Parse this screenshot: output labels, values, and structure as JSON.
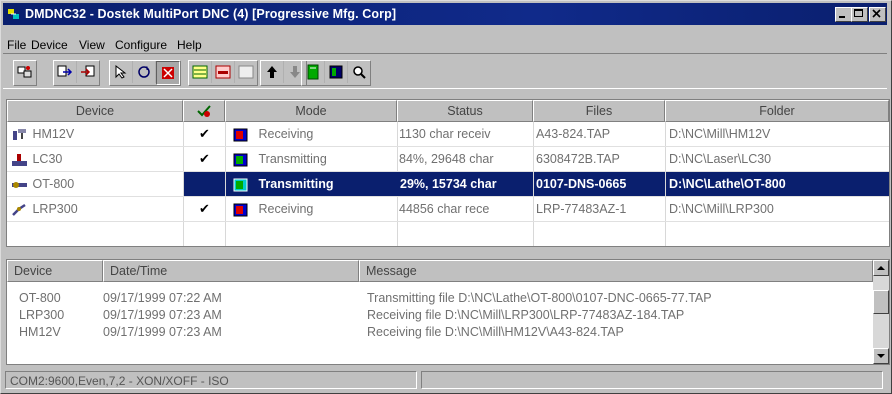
{
  "window": {
    "title": "DMDNC32 - Dostek MultiPort DNC (4) [Progressive Mfg. Corp]"
  },
  "menu": [
    "File",
    "Device",
    "View",
    "Configure",
    "Help"
  ],
  "device_table": {
    "columns": [
      "Device",
      "",
      "Mode",
      "Status",
      "Files",
      "Folder"
    ],
    "rows": [
      {
        "device": "HM12V",
        "checked": "✔",
        "mode": "Receiving",
        "status": "1130 char receiv",
        "file": "A43-824.TAP",
        "folder": "D:\\NC\\Mill\\HM12V"
      },
      {
        "device": "LC30",
        "checked": "✔",
        "mode": "Transmitting",
        "status": "84%, 29648 char",
        "file": "6308472B.TAP",
        "folder": "D:\\NC\\Laser\\LC30"
      },
      {
        "device": "OT-800",
        "checked": "",
        "mode": "Transmitting",
        "status": "29%, 15734 char",
        "file": "0107-DNS-0665",
        "folder": "D:\\NC\\Lathe\\OT-800"
      },
      {
        "device": "LRP300",
        "checked": "✔",
        "mode": "Receiving",
        "status": "44856 char rece",
        "file": "LRP-77483AZ-1",
        "folder": "D:\\NC\\Mill\\LRP300"
      }
    ],
    "selected_row": 2
  },
  "log_table": {
    "columns": [
      "Device",
      "Date/Time",
      "Message"
    ],
    "rows": [
      {
        "device": "OT-800",
        "datetime": "09/17/1999 07:22 AM",
        "message": "Transmitting file D:\\NC\\Lathe\\OT-800\\0107-DNC-0665-77.TAP"
      },
      {
        "device": "LRP300",
        "datetime": "09/17/1999 07:23 AM",
        "message": "Receiving file D:\\NC\\Mill\\LRP300\\LRP-77483AZ-184.TAP"
      },
      {
        "device": "HM12V",
        "datetime": "09/17/1999 07:23 AM",
        "message": "Receiving file D:\\NC\\Mill\\HM12V\\A43-824.TAP"
      }
    ]
  },
  "statusbar": {
    "text": "COM2:9600,Even,7,2 - XON/XOFF - ISO"
  },
  "colors": {
    "titlebar": "#0a1f6e",
    "selection": "#0a1f6e",
    "face": "#c0c0c0"
  }
}
